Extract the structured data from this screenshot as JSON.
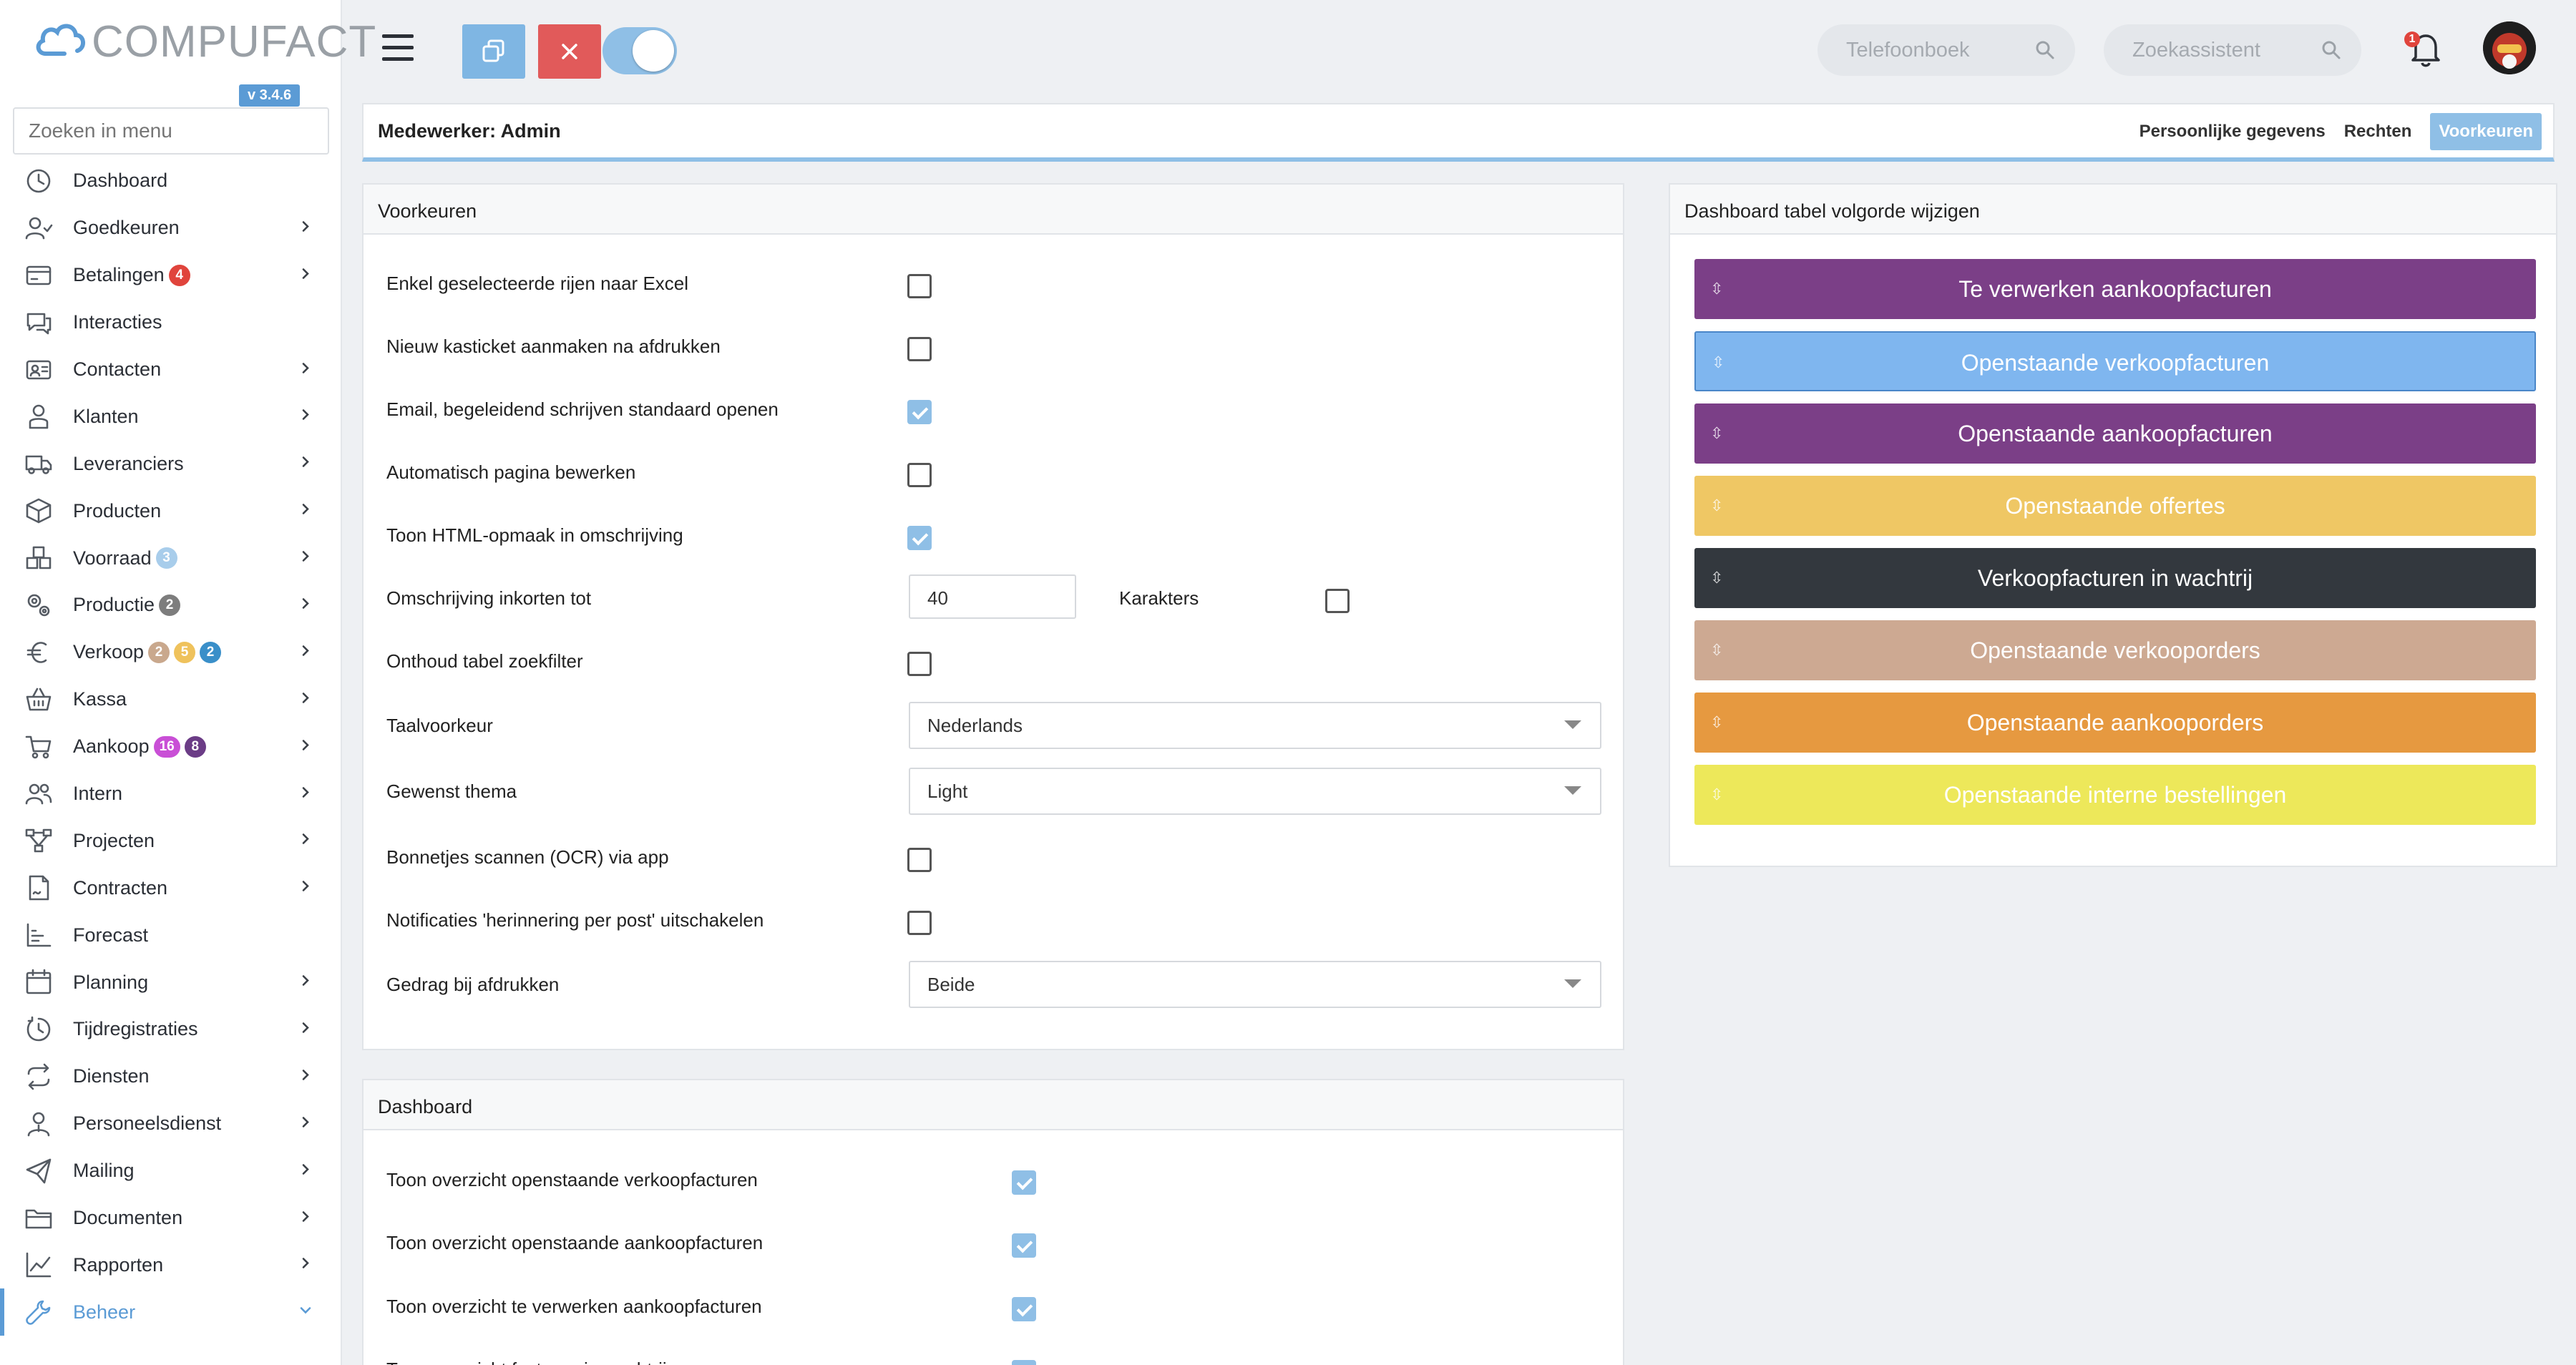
{
  "app": {
    "logo_text": "COMPUFACT",
    "version": "v 3.4.6",
    "menu_search_placeholder": "Zoeken in menu"
  },
  "sidebar": {
    "items": [
      {
        "label": "Dashboard",
        "icon": "dashboard-icon",
        "chevron": false
      },
      {
        "label": "Goedkeuren",
        "icon": "user-check-icon",
        "chevron": true
      },
      {
        "label": "Betalingen",
        "icon": "payment-icon",
        "chevron": true,
        "badges": [
          {
            "text": "4",
            "color": "#e0443c"
          }
        ]
      },
      {
        "label": "Interacties",
        "icon": "chat-icon",
        "chevron": false
      },
      {
        "label": "Contacten",
        "icon": "contact-card-icon",
        "chevron": true
      },
      {
        "label": "Klanten",
        "icon": "customer-icon",
        "chevron": true
      },
      {
        "label": "Leveranciers",
        "icon": "truck-icon",
        "chevron": true
      },
      {
        "label": "Producten",
        "icon": "box-icon",
        "chevron": true
      },
      {
        "label": "Voorraad",
        "icon": "stock-icon",
        "chevron": true,
        "badges": [
          {
            "text": "3",
            "color": "#a8cdeb"
          }
        ]
      },
      {
        "label": "Productie",
        "icon": "gears-icon",
        "chevron": true,
        "badges": [
          {
            "text": "2",
            "color": "#7d7d7d"
          }
        ]
      },
      {
        "label": "Verkoop",
        "icon": "euro-icon",
        "chevron": true,
        "badges": [
          {
            "text": "2",
            "color": "#c9a88d"
          },
          {
            "text": "5",
            "color": "#efc25c"
          },
          {
            "text": "2",
            "color": "#3a8fc9"
          }
        ]
      },
      {
        "label": "Kassa",
        "icon": "basket-icon",
        "chevron": true
      },
      {
        "label": "Aankoop",
        "icon": "cart-icon",
        "chevron": true,
        "badges": [
          {
            "text": "16",
            "color": "#c94fd6"
          },
          {
            "text": "8",
            "color": "#6b3c86"
          }
        ]
      },
      {
        "label": "Intern",
        "icon": "users-icon",
        "chevron": true
      },
      {
        "label": "Projecten",
        "icon": "project-icon",
        "chevron": true
      },
      {
        "label": "Contracten",
        "icon": "contract-icon",
        "chevron": true
      },
      {
        "label": "Forecast",
        "icon": "forecast-icon",
        "chevron": false
      },
      {
        "label": "Planning",
        "icon": "calendar-icon",
        "chevron": true
      },
      {
        "label": "Tijdregistraties",
        "icon": "clock-icon",
        "chevron": true
      },
      {
        "label": "Diensten",
        "icon": "repeat-icon",
        "chevron": true
      },
      {
        "label": "Personeelsdienst",
        "icon": "person-icon",
        "chevron": true
      },
      {
        "label": "Mailing",
        "icon": "send-icon",
        "chevron": true
      },
      {
        "label": "Documenten",
        "icon": "folder-icon",
        "chevron": true
      },
      {
        "label": "Rapporten",
        "icon": "chart-icon",
        "chevron": true
      },
      {
        "label": "Beheer",
        "icon": "wrench-icon",
        "chevron": true,
        "active": true
      }
    ]
  },
  "topbar": {
    "phonebook_placeholder": "Telefoonboek",
    "assistant_placeholder": "Zoekassistent",
    "notification_count": "1",
    "colors": {
      "copy_button": "#7fb6e3",
      "close_button": "#e15a5a",
      "toggle": "#8fbfe6"
    }
  },
  "employee": {
    "title": "Medewerker: Admin",
    "tabs": [
      "Persoonlijke gegevens",
      "Rechten",
      "Voorkeuren"
    ],
    "active_tab": "Voorkeuren"
  },
  "preferences": {
    "title": "Voorkeuren",
    "rows": [
      {
        "label": "Enkel geselecteerde rijen naar Excel",
        "type": "checkbox",
        "checked": false
      },
      {
        "label": "Nieuw kasticket aanmaken na afdrukken",
        "type": "checkbox",
        "checked": false
      },
      {
        "label": "Email, begeleidend schrijven standaard openen",
        "type": "checkbox",
        "checked": true
      },
      {
        "label": "Automatisch pagina bewerken",
        "type": "checkbox",
        "checked": false
      },
      {
        "label": "Toon HTML-opmaak in omschrijving",
        "type": "checkbox",
        "checked": true
      },
      {
        "label": "Omschrijving inkorten tot",
        "type": "number",
        "value": "40",
        "suffix": "Karakters",
        "checked": false
      },
      {
        "label": "Onthoud tabel zoekfilter",
        "type": "checkbox",
        "checked": false
      },
      {
        "label": "Taalvoorkeur",
        "type": "select",
        "value": "Nederlands"
      },
      {
        "label": "Gewenst thema",
        "type": "select",
        "value": "Light"
      },
      {
        "label": "Bonnetjes scannen (OCR) via app",
        "type": "checkbox",
        "checked": false
      },
      {
        "label": "Notificaties 'herinnering per post' uitschakelen",
        "type": "checkbox",
        "checked": false
      },
      {
        "label": "Gedrag bij afdrukken",
        "type": "select",
        "value": "Beide"
      }
    ]
  },
  "dashboard_order": {
    "title": "Dashboard tabel volgorde wijzigen",
    "items": [
      {
        "label": "Te verwerken aankoopfacturen",
        "color": "#7b3f87"
      },
      {
        "label": "Openstaande verkoopfacturen",
        "color": "#7fb6ef"
      },
      {
        "label": "Openstaande aankoopfacturen",
        "color": "#7b3f87"
      },
      {
        "label": "Openstaande offertes",
        "color": "#efc764"
      },
      {
        "label": "Verkoopfacturen in wachtrij",
        "color": "#33383e"
      },
      {
        "label": "Openstaande verkooporders",
        "color": "#cda992"
      },
      {
        "label": "Openstaande aankooporders",
        "color": "#e69940"
      },
      {
        "label": "Openstaande interne bestellingen",
        "color": "#ede85a"
      }
    ]
  },
  "dashboard": {
    "title": "Dashboard",
    "rows": [
      {
        "label": "Toon overzicht openstaande verkoopfacturen",
        "checked": true
      },
      {
        "label": "Toon overzicht openstaande aankoopfacturen",
        "checked": true
      },
      {
        "label": "Toon overzicht te verwerken aankoopfacturen",
        "checked": true
      },
      {
        "label": "Toon overzicht facturen in wachtrij",
        "checked": true
      }
    ]
  }
}
